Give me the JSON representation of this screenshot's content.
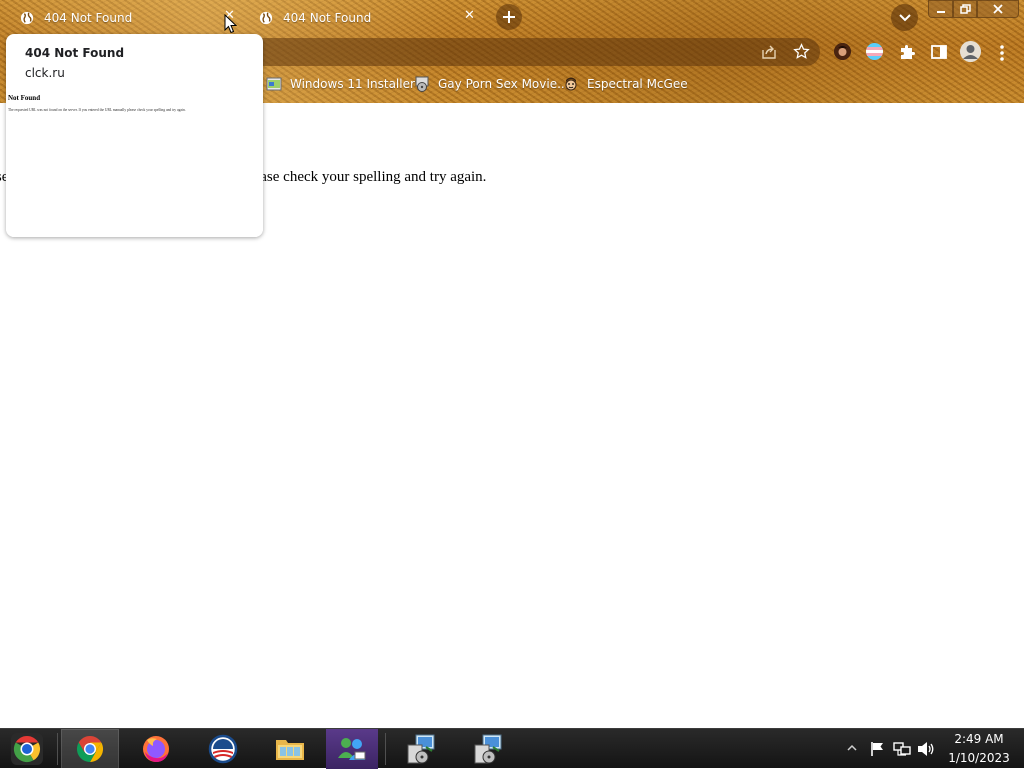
{
  "tabs": [
    {
      "title": "404 Not Found",
      "close_glyph": "✕"
    },
    {
      "title": "404 Not Found",
      "close_glyph": "✕"
    }
  ],
  "new_tab_glyph": "+",
  "window_controls": {
    "minimize": "—",
    "maximize": "❐",
    "close": "✕"
  },
  "bookmarks": [
    {
      "label": "Windows 11 Installer",
      "icon": "windows-installer-icon"
    },
    {
      "label": "Gay Porn Sex Movie...",
      "icon": "disc-icon"
    },
    {
      "label": "Espectral McGee",
      "icon": "face-icon"
    }
  ],
  "hover_card": {
    "title": "404 Not Found",
    "domain": "clck.ru",
    "preview_heading": "Not Found",
    "preview_text": "The requested URL was not found on the server. If you entered the URL manually please check your spelling and try again."
  },
  "page": {
    "visible_text": "he server. If you entered the URL manually please check your spelling and try again."
  },
  "taskbar": {
    "apps": [
      "start-orb",
      "chrome",
      "firefox",
      "obama-logo",
      "file-explorer",
      "windows-live-messenger",
      "installer-1",
      "installer-2"
    ],
    "clock_time": "2:49 AM",
    "clock_date": "1/10/2023"
  },
  "colors": {
    "theme_brown": "#b8741c",
    "taskbar": "#1c1c1c",
    "page_bg": "#ffffff"
  }
}
